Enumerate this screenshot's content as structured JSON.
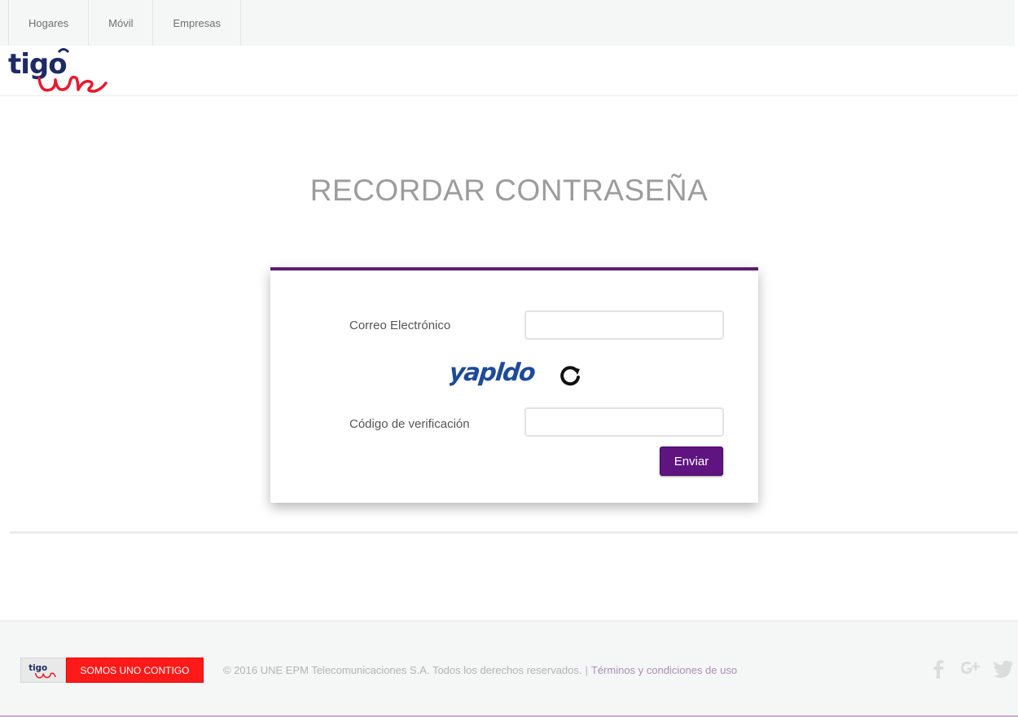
{
  "nav": {
    "tabs": [
      {
        "label": "Hogares"
      },
      {
        "label": "Móvil"
      },
      {
        "label": "Empresas"
      }
    ]
  },
  "brand": {
    "logo_icon": "tigo-une-logo",
    "colors": {
      "primary_purple": "#5b1f6e",
      "button_purple": "#5f1480",
      "logo_navy": "#1d2a63",
      "logo_red": "#e8192c",
      "slogan_red": "#ff1a1a"
    }
  },
  "page": {
    "title": "RECORDAR CONTRASEÑA"
  },
  "form": {
    "email_label": "Correo Electrónico",
    "email_value": "",
    "captcha_text": "yapldo",
    "captcha_refresh_icon": "refresh-icon",
    "code_label": "Código de verificación",
    "code_value": "",
    "submit_label": "Enviar"
  },
  "footer": {
    "slogan": "SOMOS UNO CONTIGO",
    "copyright": "© 2016 UNE EPM Telecomunicaciones S.A. Todos los derechos reservados.",
    "separator": "|",
    "terms_link": "Términos y condiciones de uso",
    "social_icons": [
      "facebook-icon",
      "google-plus-icon",
      "twitter-icon"
    ]
  }
}
